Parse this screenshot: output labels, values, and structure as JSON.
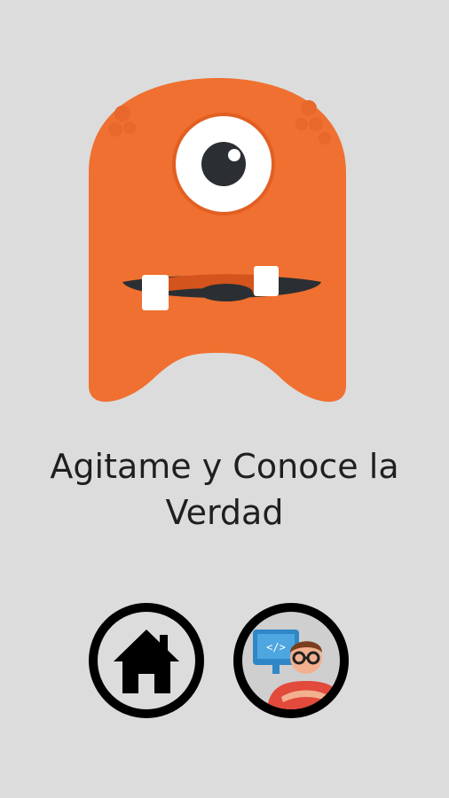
{
  "screen": {
    "background": "#dcdcdc",
    "prompt_text": "Agitame y Conoce la Verdad"
  },
  "monster": {
    "icon": "one-eyed-orange-monster",
    "body_color": "#ef7030",
    "eye_white": "#ffffff",
    "pupil_color": "#2b2f33",
    "mouth_color": "#2b2f33"
  },
  "buttons": {
    "home": {
      "icon": "home-icon"
    },
    "developer": {
      "icon": "developer-avatar-icon"
    }
  }
}
